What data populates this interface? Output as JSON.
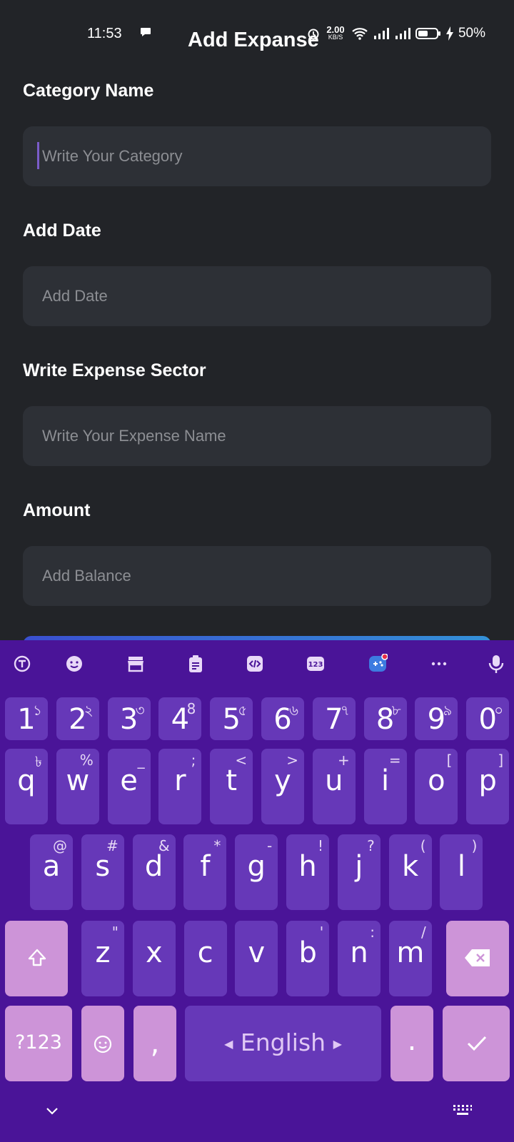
{
  "status_bar": {
    "time": "11:53",
    "net_speed_value": "2.00",
    "net_speed_unit": "KB/S",
    "battery_percent": "50%"
  },
  "header": {
    "title": "Add Expanse"
  },
  "form": {
    "category": {
      "label": "Category Name",
      "placeholder": "Write Your Category",
      "value": ""
    },
    "date": {
      "label": "Add Date",
      "placeholder": "Add Date",
      "value": ""
    },
    "sector": {
      "label": "Write Expense Sector",
      "placeholder": "Write Your Expense Name",
      "value": ""
    },
    "amount": {
      "label": "Amount",
      "placeholder": "Add Balance",
      "value": ""
    }
  },
  "keyboard": {
    "toolbar_icons": [
      "translate-icon",
      "emoji-icon",
      "store-icon",
      "clipboard-icon",
      "code-icon",
      "numbers-icon",
      "game-icon",
      "more-icon",
      "mic-icon"
    ],
    "number_row": [
      {
        "main": "1",
        "sec": "১"
      },
      {
        "main": "2",
        "sec": "২"
      },
      {
        "main": "3",
        "sec": "৩"
      },
      {
        "main": "4",
        "sec": "8"
      },
      {
        "main": "5",
        "sec": "৫"
      },
      {
        "main": "6",
        "sec": "৬"
      },
      {
        "main": "7",
        "sec": "৭"
      },
      {
        "main": "8",
        "sec": "৮"
      },
      {
        "main": "9",
        "sec": "৯"
      },
      {
        "main": "0",
        "sec": "০"
      }
    ],
    "row1": [
      {
        "main": "q",
        "sec": "৳"
      },
      {
        "main": "w",
        "sec": "%"
      },
      {
        "main": "e",
        "sec": "_"
      },
      {
        "main": "r",
        "sec": ";"
      },
      {
        "main": "t",
        "sec": "<"
      },
      {
        "main": "y",
        "sec": ">"
      },
      {
        "main": "u",
        "sec": "+"
      },
      {
        "main": "i",
        "sec": "="
      },
      {
        "main": "o",
        "sec": "["
      },
      {
        "main": "p",
        "sec": "]"
      }
    ],
    "row2": [
      {
        "main": "a",
        "sec": "@"
      },
      {
        "main": "s",
        "sec": "#"
      },
      {
        "main": "d",
        "sec": "&"
      },
      {
        "main": "f",
        "sec": "*"
      },
      {
        "main": "g",
        "sec": "-"
      },
      {
        "main": "h",
        "sec": "!"
      },
      {
        "main": "j",
        "sec": "?"
      },
      {
        "main": "k",
        "sec": "("
      },
      {
        "main": "l",
        "sec": ")"
      }
    ],
    "row3": [
      {
        "main": "z",
        "sec": "\""
      },
      {
        "main": "x",
        "sec": ""
      },
      {
        "main": "c",
        "sec": ""
      },
      {
        "main": "v",
        "sec": ""
      },
      {
        "main": "b",
        "sec": "'"
      },
      {
        "main": "n",
        "sec": ":"
      },
      {
        "main": "m",
        "sec": "/"
      }
    ],
    "symbols_key": "?123",
    "comma_key": ",",
    "space_label": "English",
    "period_key": ".",
    "colors": {
      "background": "#4a1498",
      "key": "#6638b8",
      "function_key": "#cd94d8"
    }
  }
}
